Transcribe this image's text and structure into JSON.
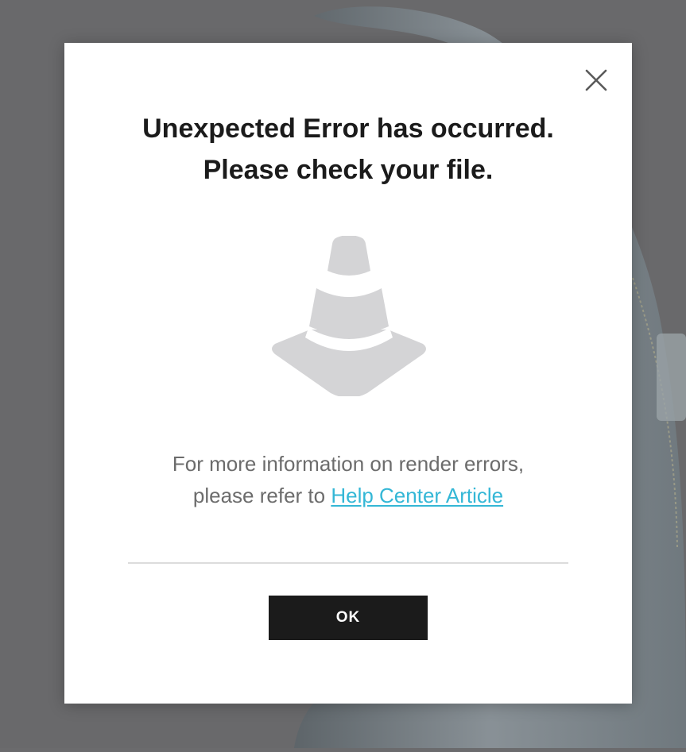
{
  "dialog": {
    "title_line1": "Unexpected Error has occurred.",
    "title_line2": "Please check your file.",
    "illustration_icon": "traffic-cone-icon",
    "info_line1": "For more information on render errors,",
    "info_line2_prefix": "please refer to ",
    "help_link_label": "Help Center Article",
    "ok_label": "OK",
    "close_icon": "close-icon"
  },
  "colors": {
    "backdrop": "#6b6b6d",
    "dialog_bg": "#ffffff",
    "title_text": "#1b1b1b",
    "info_text": "#6c6c6c",
    "link": "#34b7d6",
    "button_bg": "#1b1b1b",
    "button_text": "#ffffff",
    "cone": "#d4d4d6"
  }
}
